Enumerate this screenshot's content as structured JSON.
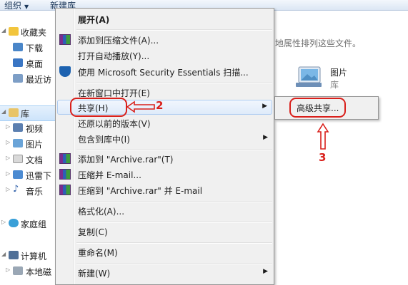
{
  "toolbar": {
    "organize": "组织",
    "new_library": "新建库"
  },
  "nav": {
    "favorites": "收藏夹",
    "downloads": "下载",
    "desktop": "桌面",
    "recent": "最近访",
    "libraries": "库",
    "videos": "视频",
    "pictures": "图片",
    "documents": "文档",
    "thunder": "迅雷下",
    "music": "音乐",
    "homegroup": "家庭组",
    "computer": "计算机",
    "local_disk": "本地磁"
  },
  "content": {
    "hint": "地属性排列这些文件。",
    "library_name": "图片",
    "library_type": "库"
  },
  "menu": {
    "items": [
      {
        "label": "展开(A)"
      },
      {
        "label": "添加到压缩文件(A)..."
      },
      {
        "label": "打开自动播放(Y)..."
      },
      {
        "label": "使用 Microsoft Security Essentials 扫描..."
      },
      {
        "label": "在新窗口中打开(E)"
      },
      {
        "label": "共享(H)"
      },
      {
        "label": "还原以前的版本(V)"
      },
      {
        "label": "包含到库中(I)"
      },
      {
        "label": "添加到 \"Archive.rar\"(T)"
      },
      {
        "label": "压缩并 E-mail..."
      },
      {
        "label": "压缩到 \"Archive.rar\" 并 E-mail"
      },
      {
        "label": "格式化(A)..."
      },
      {
        "label": "复制(C)"
      },
      {
        "label": "重命名(M)"
      },
      {
        "label": "新建(W)"
      }
    ]
  },
  "submenu": {
    "advanced_sharing": "高级共享..."
  },
  "annotations": {
    "step2": "2",
    "step3": "3",
    "color": "#d9201b"
  }
}
